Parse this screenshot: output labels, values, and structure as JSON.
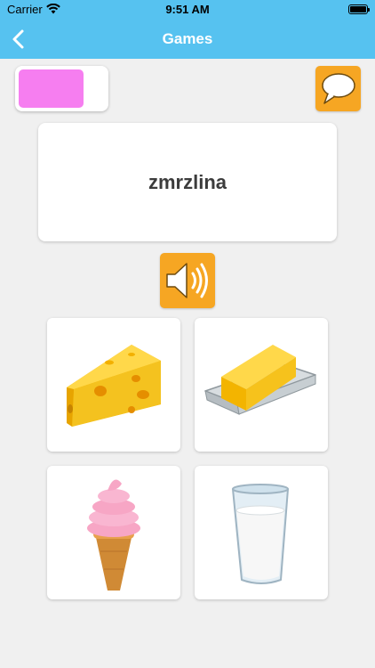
{
  "status_bar": {
    "carrier": "Carrier",
    "time": "9:51 AM"
  },
  "nav": {
    "title": "Games",
    "back_icon": "chevron-left-icon"
  },
  "colors": {
    "header": "#56c2f0",
    "accent": "#f6a623",
    "swatch": "#f67ef0"
  },
  "game": {
    "word": "zmrzlina",
    "speech_icon": "speech-bubble-icon",
    "sound_icon": "speaker-icon",
    "choices": [
      {
        "icon": "cheese-icon"
      },
      {
        "icon": "butter-icon"
      },
      {
        "icon": "ice-cream-icon"
      },
      {
        "icon": "milk-glass-icon"
      }
    ]
  }
}
